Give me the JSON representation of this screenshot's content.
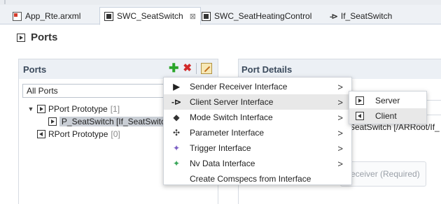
{
  "tabs": [
    {
      "label": "App_Rte.arxml",
      "icon": "arxml-file-icon"
    },
    {
      "label": "SWC_SeatSwitch",
      "icon": "component-icon",
      "close": "⊠",
      "active": true
    },
    {
      "label": "SWC_SeatHeatingControl",
      "icon": "component-icon"
    },
    {
      "label": "If_SeatSwitch",
      "icon": "interface-icon"
    }
  ],
  "editor": {
    "title": "Ports"
  },
  "ports": {
    "header": "Ports",
    "filter_value": "All Ports",
    "tree": {
      "pport": {
        "label": "PPort Prototype",
        "count": "[1]"
      },
      "selected_port": {
        "label": "P_SeatSwitch [If_SeatSwitc"
      },
      "rport": {
        "label": "RPort Prototype",
        "count": "[0]"
      }
    }
  },
  "details": {
    "header": "Port Details",
    "interface_text": "SeatSwitch [/ARRoot/If_",
    "receiver_button": "eceiver (Required)"
  },
  "context_menu": {
    "items": [
      {
        "label": "Sender Receiver Interface",
        "icon": "sender-receiver-icon",
        "submenu": true
      },
      {
        "label": "Client Server Interface",
        "icon": "client-server-icon",
        "submenu": true,
        "hover": true
      },
      {
        "label": "Mode Switch Interface",
        "icon": "mode-switch-icon",
        "submenu": true
      },
      {
        "label": "Parameter Interface",
        "icon": "parameter-icon",
        "submenu": true
      },
      {
        "label": "Trigger Interface",
        "icon": "trigger-icon",
        "submenu": true
      },
      {
        "label": "Nv Data Interface",
        "icon": "nv-data-icon",
        "submenu": true
      },
      {
        "label": "Create Comspecs from Interface",
        "icon": "",
        "submenu": false
      }
    ],
    "arrow": ">"
  },
  "submenu": {
    "items": [
      {
        "label": "Server",
        "icon": "server-port-icon"
      },
      {
        "label": "Client",
        "icon": "client-port-icon",
        "hover": true
      }
    ]
  },
  "colors": {
    "accent": "#3b4a5c",
    "header_bg": "#ecf0f5",
    "add": "#2aa52a",
    "delete": "#d12a2a"
  }
}
